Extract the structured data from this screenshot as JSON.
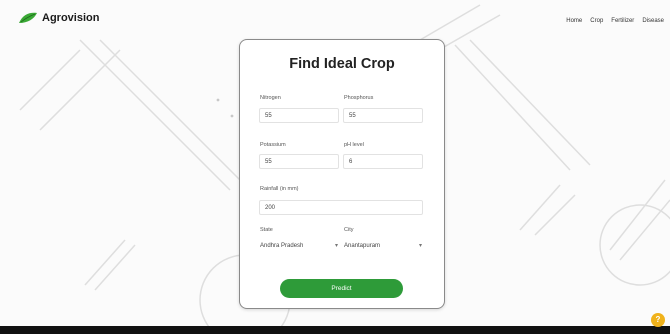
{
  "brand": {
    "name": "Agrovision"
  },
  "nav": {
    "links": [
      "Home",
      "Crop",
      "Fertilizer",
      "Disease"
    ]
  },
  "form": {
    "title": "Find Ideal Crop",
    "nitrogen": {
      "label": "Nitrogen",
      "value": "55"
    },
    "phosphorus": {
      "label": "Phosphorus",
      "value": "55"
    },
    "potassium": {
      "label": "Potassium",
      "value": "55"
    },
    "ph": {
      "label": "pH level",
      "value": "6"
    },
    "rainfall": {
      "label": "Rainfall (in mm)",
      "value": "200"
    },
    "state": {
      "label": "State",
      "value": "Andhra Pradesh"
    },
    "city": {
      "label": "City",
      "value": "Anantapuram"
    },
    "predict_label": "Predict"
  },
  "colors": {
    "accent": "#2e9b39",
    "help": "#f0b21b"
  },
  "help": {
    "symbol": "?"
  }
}
